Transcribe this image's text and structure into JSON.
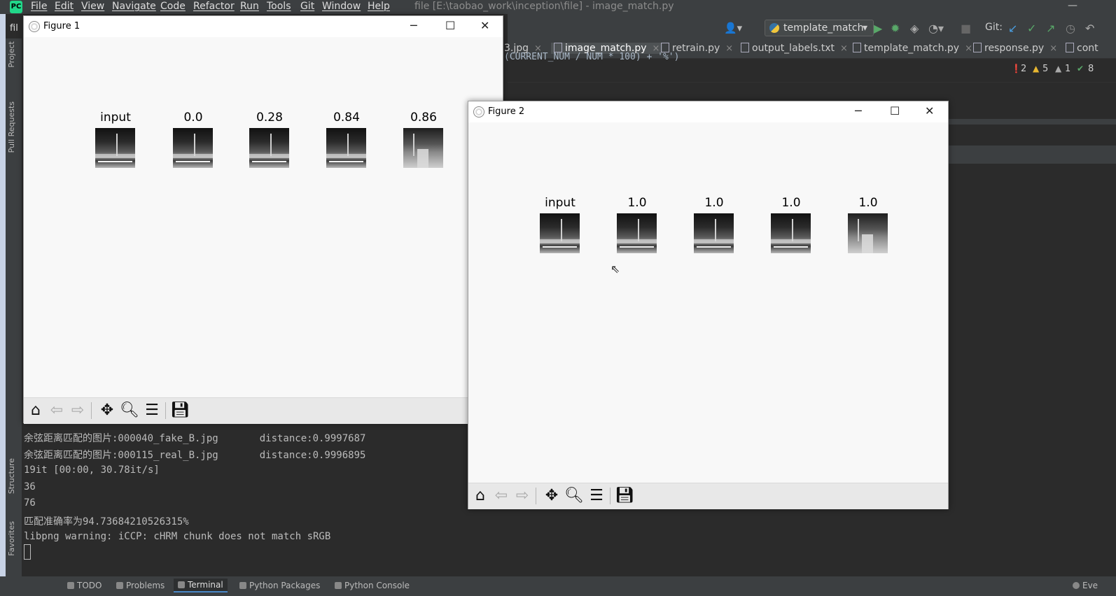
{
  "ide": {
    "menus": [
      "File",
      "Edit",
      "View",
      "Navigate",
      "Code",
      "Refactor",
      "Run",
      "Tools",
      "Git",
      "Window",
      "Help"
    ],
    "window_title": "file [E:\\taobao_work\\inception\\file] - image_match.py",
    "project_label": "fil",
    "side_tabs": [
      "Project",
      "Pull Requests",
      "Structure",
      "Favorites"
    ],
    "run_config": "template_match",
    "git_label": "Git:",
    "tabs": [
      {
        "label": "3.jpg",
        "active": false
      },
      {
        "label": "image_match.py",
        "active": true
      },
      {
        "label": "retrain.py",
        "active": false
      },
      {
        "label": "output_labels.txt",
        "active": false
      },
      {
        "label": "template_match.py",
        "active": false
      },
      {
        "label": "response.py",
        "active": false
      },
      {
        "label": "cont",
        "active": false
      }
    ],
    "inspections": {
      "errors": "2",
      "warnings": "5",
      "weak_warnings": "1",
      "ok": "8"
    },
    "editor_fragment": "(CURRENT_NUM / NUM * 100) + '%')",
    "terminal": [
      "余弦距离匹配的图片:000040_fake_B.jpg       distance:0.9997687",
      "余弦距离匹配的图片:000115_real_B.jpg       distance:0.9996895",
      "19it [00:00, 30.78it/s]",
      "36",
      "76",
      "匹配准确率为94.73684210526315%",
      "libpng warning: iCCP: cHRM chunk does not match sRGB"
    ],
    "bottom_tabs": [
      {
        "label": "TODO",
        "active": false
      },
      {
        "label": "Problems",
        "active": false
      },
      {
        "label": "Terminal",
        "active": true
      },
      {
        "label": "Python Packages",
        "active": false
      },
      {
        "label": "Python Console",
        "active": false
      },
      {
        "label": "Eve",
        "active": false
      }
    ]
  },
  "figure1": {
    "title": "Figure 1",
    "labels": [
      "input",
      "0.0",
      "0.28",
      "0.84",
      "0.86"
    ]
  },
  "figure2": {
    "title": "Figure 2",
    "labels": [
      "input",
      "1.0",
      "1.0",
      "1.0",
      "1.0"
    ]
  },
  "icons": {
    "home": "home-icon",
    "back": "arrow-left-icon",
    "forward": "arrow-right-icon",
    "pan": "move-icon",
    "zoom": "magnifier-icon",
    "subplots": "sliders-icon",
    "save": "floppy-icon"
  },
  "colors": {
    "ide_bg": "#2b2b2b",
    "ide_panel": "#3c3f41",
    "figure_bg": "#f8f8f8",
    "toolbar_bg": "#e8e8e8",
    "run_green": "#59a869",
    "error_red": "#e05555",
    "warn_yellow": "#e8b731"
  }
}
